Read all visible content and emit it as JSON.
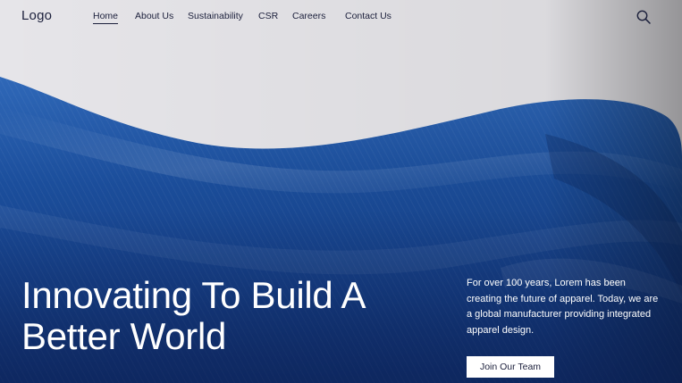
{
  "header": {
    "logo": "Logo",
    "nav": [
      {
        "label": "Home",
        "active": true
      },
      {
        "label": "About Us",
        "active": false
      },
      {
        "label": "Sustainability",
        "active": false
      },
      {
        "label": "CSR",
        "active": false
      },
      {
        "label": "Careers",
        "active": false
      },
      {
        "label": "Contact Us",
        "active": false
      }
    ],
    "search_icon": "search-icon"
  },
  "hero": {
    "headline_line1": "Innovating To Build A",
    "headline_line2": "Better World",
    "blurb": "For over 100 years, Lorem has been creating the future of apparel. Today, we are a global manufacturer providing integrated apparel design.",
    "cta_label": "Join Our Team"
  },
  "colors": {
    "background": "#e6e5e9",
    "fabric_blue": "#1a4b97",
    "text_dark": "#1b1f3b",
    "text_light": "#ffffff"
  }
}
